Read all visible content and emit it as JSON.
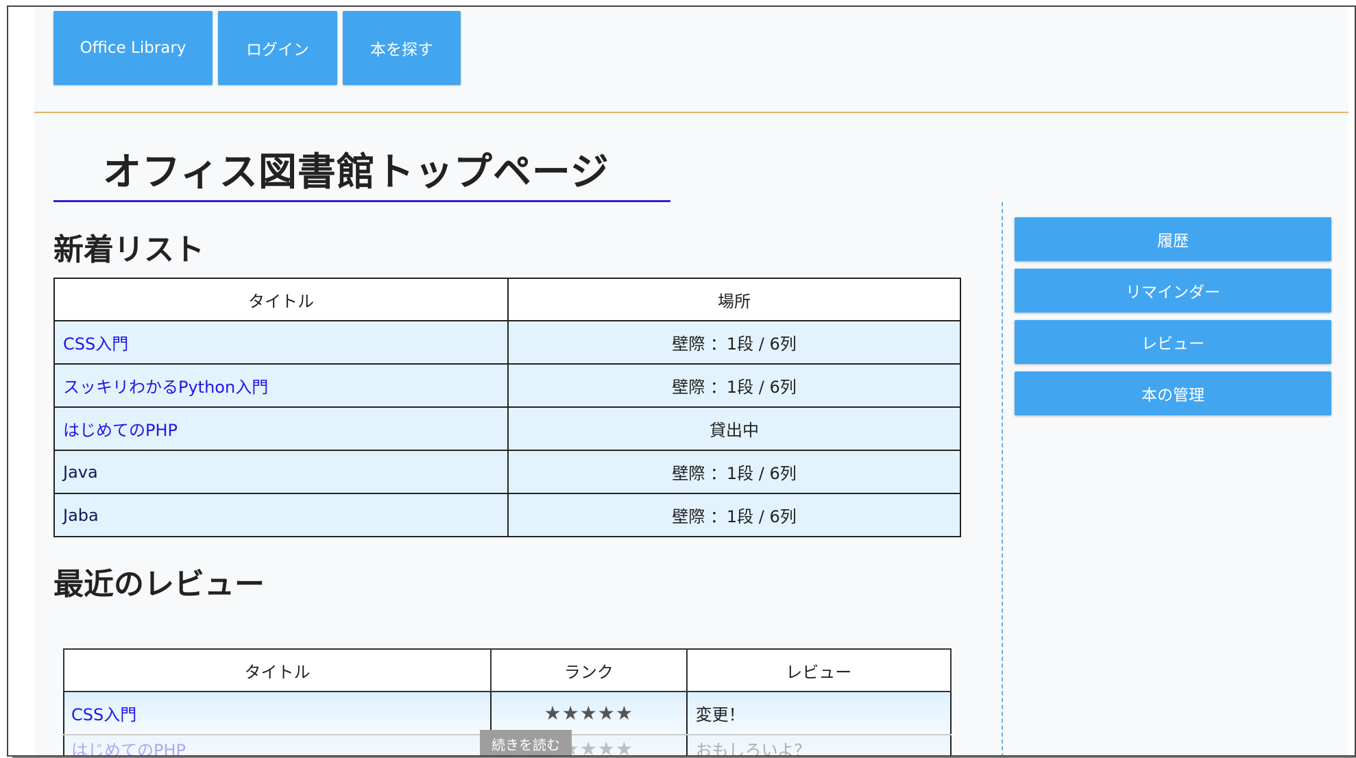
{
  "nav": {
    "items": [
      "Office Library",
      "ログイン",
      "本を探す"
    ]
  },
  "page_title": "オフィス図書館トップページ",
  "new_list": {
    "heading": "新着リスト",
    "headers": [
      "タイトル",
      "場所"
    ],
    "rows": [
      {
        "title": "CSS入門",
        "location": "壁際 ：1段 / 6列"
      },
      {
        "title": "スッキリわかるPython入門",
        "location": "壁際 ：1段 / 6列"
      },
      {
        "title": "はじめてのPHP",
        "location": "貸出中"
      },
      {
        "title": "Java",
        "location": "壁際 ：1段 / 6列"
      },
      {
        "title": "Jaba",
        "location": "壁際 ：1段 / 6列"
      }
    ]
  },
  "reviews": {
    "heading": "最近のレビュー",
    "headers": [
      "タイトル",
      "ランク",
      "レビュー"
    ],
    "rows": [
      {
        "title": "CSS入門",
        "rank": "★★★★★",
        "review": "変更！"
      },
      {
        "title": "はじめてのPHP",
        "rank": "★★★★★",
        "review": "おもしろいよ？"
      }
    ],
    "read_more": "続きを読む"
  },
  "sidebar": {
    "items": [
      "履歴",
      "リマインダー",
      "レビュー",
      "本の管理"
    ]
  },
  "colors": {
    "button_blue": "#42a5f0",
    "link_blue": "#1d17e6",
    "title_underline": "#2d23c9",
    "header_rule": "#e0b467",
    "row_bg": "#e3f3fd"
  }
}
